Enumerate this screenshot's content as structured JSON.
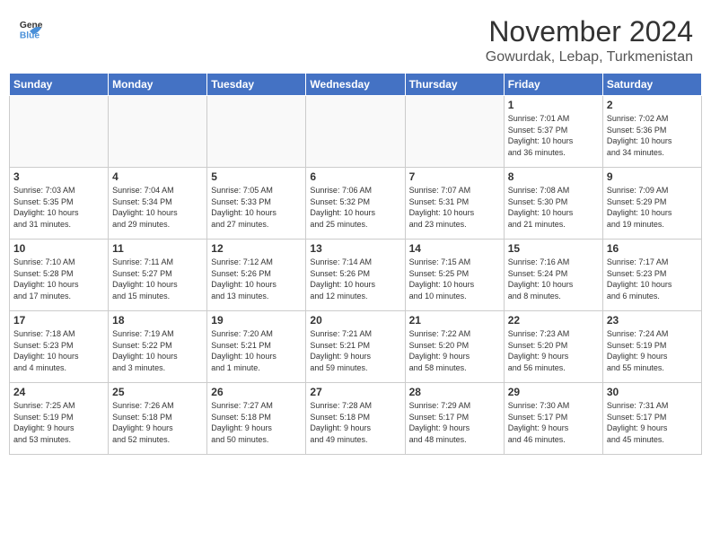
{
  "header": {
    "logo": {
      "general": "General",
      "blue": "Blue"
    },
    "month": "November 2024",
    "location": "Gowurdak, Lebap, Turkmenistan"
  },
  "weekdays": [
    "Sunday",
    "Monday",
    "Tuesday",
    "Wednesday",
    "Thursday",
    "Friday",
    "Saturday"
  ],
  "weeks": [
    [
      {
        "day": "",
        "info": ""
      },
      {
        "day": "",
        "info": ""
      },
      {
        "day": "",
        "info": ""
      },
      {
        "day": "",
        "info": ""
      },
      {
        "day": "",
        "info": ""
      },
      {
        "day": "1",
        "info": "Sunrise: 7:01 AM\nSunset: 5:37 PM\nDaylight: 10 hours\nand 36 minutes."
      },
      {
        "day": "2",
        "info": "Sunrise: 7:02 AM\nSunset: 5:36 PM\nDaylight: 10 hours\nand 34 minutes."
      }
    ],
    [
      {
        "day": "3",
        "info": "Sunrise: 7:03 AM\nSunset: 5:35 PM\nDaylight: 10 hours\nand 31 minutes."
      },
      {
        "day": "4",
        "info": "Sunrise: 7:04 AM\nSunset: 5:34 PM\nDaylight: 10 hours\nand 29 minutes."
      },
      {
        "day": "5",
        "info": "Sunrise: 7:05 AM\nSunset: 5:33 PM\nDaylight: 10 hours\nand 27 minutes."
      },
      {
        "day": "6",
        "info": "Sunrise: 7:06 AM\nSunset: 5:32 PM\nDaylight: 10 hours\nand 25 minutes."
      },
      {
        "day": "7",
        "info": "Sunrise: 7:07 AM\nSunset: 5:31 PM\nDaylight: 10 hours\nand 23 minutes."
      },
      {
        "day": "8",
        "info": "Sunrise: 7:08 AM\nSunset: 5:30 PM\nDaylight: 10 hours\nand 21 minutes."
      },
      {
        "day": "9",
        "info": "Sunrise: 7:09 AM\nSunset: 5:29 PM\nDaylight: 10 hours\nand 19 minutes."
      }
    ],
    [
      {
        "day": "10",
        "info": "Sunrise: 7:10 AM\nSunset: 5:28 PM\nDaylight: 10 hours\nand 17 minutes."
      },
      {
        "day": "11",
        "info": "Sunrise: 7:11 AM\nSunset: 5:27 PM\nDaylight: 10 hours\nand 15 minutes."
      },
      {
        "day": "12",
        "info": "Sunrise: 7:12 AM\nSunset: 5:26 PM\nDaylight: 10 hours\nand 13 minutes."
      },
      {
        "day": "13",
        "info": "Sunrise: 7:14 AM\nSunset: 5:26 PM\nDaylight: 10 hours\nand 12 minutes."
      },
      {
        "day": "14",
        "info": "Sunrise: 7:15 AM\nSunset: 5:25 PM\nDaylight: 10 hours\nand 10 minutes."
      },
      {
        "day": "15",
        "info": "Sunrise: 7:16 AM\nSunset: 5:24 PM\nDaylight: 10 hours\nand 8 minutes."
      },
      {
        "day": "16",
        "info": "Sunrise: 7:17 AM\nSunset: 5:23 PM\nDaylight: 10 hours\nand 6 minutes."
      }
    ],
    [
      {
        "day": "17",
        "info": "Sunrise: 7:18 AM\nSunset: 5:23 PM\nDaylight: 10 hours\nand 4 minutes."
      },
      {
        "day": "18",
        "info": "Sunrise: 7:19 AM\nSunset: 5:22 PM\nDaylight: 10 hours\nand 3 minutes."
      },
      {
        "day": "19",
        "info": "Sunrise: 7:20 AM\nSunset: 5:21 PM\nDaylight: 10 hours\nand 1 minute."
      },
      {
        "day": "20",
        "info": "Sunrise: 7:21 AM\nSunset: 5:21 PM\nDaylight: 9 hours\nand 59 minutes."
      },
      {
        "day": "21",
        "info": "Sunrise: 7:22 AM\nSunset: 5:20 PM\nDaylight: 9 hours\nand 58 minutes."
      },
      {
        "day": "22",
        "info": "Sunrise: 7:23 AM\nSunset: 5:20 PM\nDaylight: 9 hours\nand 56 minutes."
      },
      {
        "day": "23",
        "info": "Sunrise: 7:24 AM\nSunset: 5:19 PM\nDaylight: 9 hours\nand 55 minutes."
      }
    ],
    [
      {
        "day": "24",
        "info": "Sunrise: 7:25 AM\nSunset: 5:19 PM\nDaylight: 9 hours\nand 53 minutes."
      },
      {
        "day": "25",
        "info": "Sunrise: 7:26 AM\nSunset: 5:18 PM\nDaylight: 9 hours\nand 52 minutes."
      },
      {
        "day": "26",
        "info": "Sunrise: 7:27 AM\nSunset: 5:18 PM\nDaylight: 9 hours\nand 50 minutes."
      },
      {
        "day": "27",
        "info": "Sunrise: 7:28 AM\nSunset: 5:18 PM\nDaylight: 9 hours\nand 49 minutes."
      },
      {
        "day": "28",
        "info": "Sunrise: 7:29 AM\nSunset: 5:17 PM\nDaylight: 9 hours\nand 48 minutes."
      },
      {
        "day": "29",
        "info": "Sunrise: 7:30 AM\nSunset: 5:17 PM\nDaylight: 9 hours\nand 46 minutes."
      },
      {
        "day": "30",
        "info": "Sunrise: 7:31 AM\nSunset: 5:17 PM\nDaylight: 9 hours\nand 45 minutes."
      }
    ]
  ]
}
